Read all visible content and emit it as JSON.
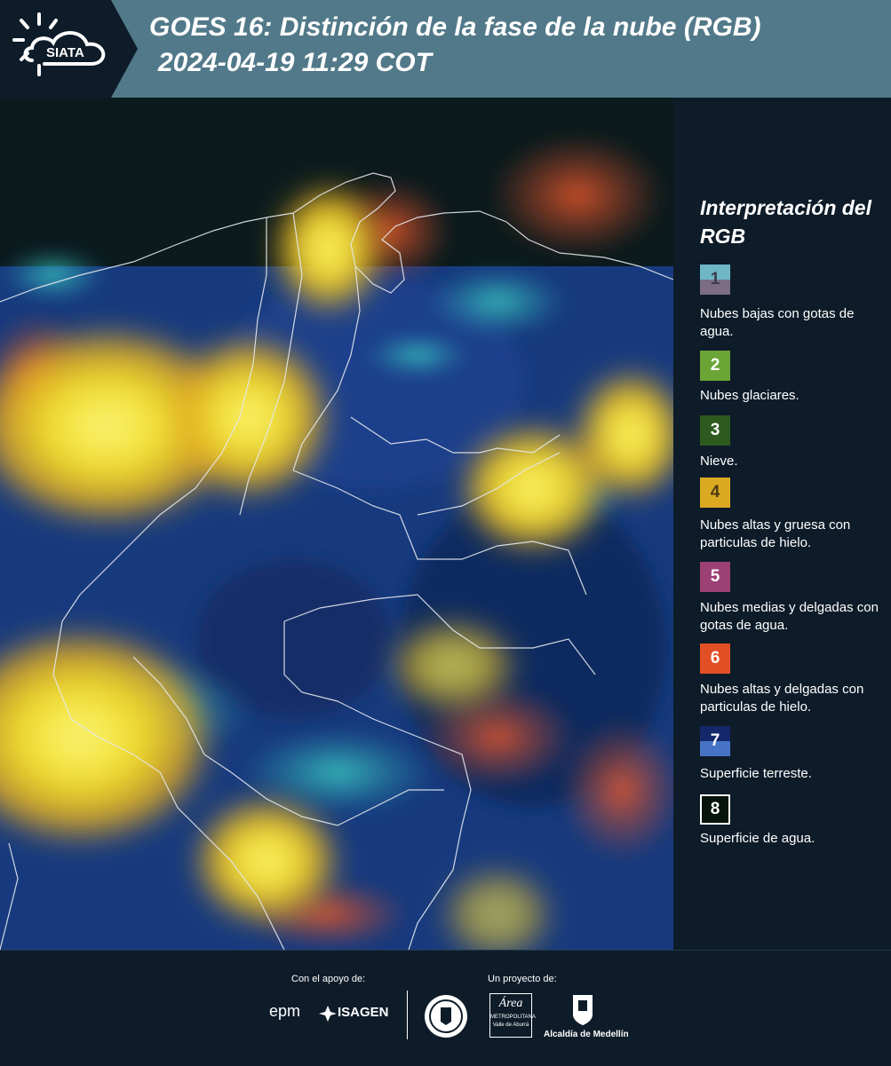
{
  "header": {
    "logo_text": "SIATA",
    "title_line1": "GOES 16: Distinción de la fase de la nube (RGB)",
    "title_line2": "2024-04-19 11:29 COT"
  },
  "legend": {
    "title": "Interpretación del RGB",
    "items": [
      {
        "number": "1",
        "label": "Nubes bajas con gotas de agua.",
        "color_top": "#6fb7c6",
        "color_bottom": "#7c6c86"
      },
      {
        "number": "2",
        "label": "Nubes glaciares.",
        "color": "#6aa536"
      },
      {
        "number": "3",
        "label": "Nieve.",
        "color": "#2e5a1f"
      },
      {
        "number": "4",
        "label": "Nubes altas y gruesa con particulas de hielo.",
        "color": "#dcaa22"
      },
      {
        "number": "5",
        "label": "Nubes medias y delgadas con gotas de agua.",
        "color": "#9c4076"
      },
      {
        "number": "6",
        "label": "Nubes altas y delgadas con particulas de hielo.",
        "color": "#e24f25"
      },
      {
        "number": "7",
        "label": "Superficie terreste.",
        "color_top": "#14276a",
        "color_bottom": "#4773c6"
      },
      {
        "number": "8",
        "label": "Superficie de agua.",
        "color": "#06130a"
      }
    ]
  },
  "footer": {
    "support_label": "Con el apoyo de:",
    "project_label": "Un proyecto de:",
    "sponsors": [
      "epm",
      "ISAGEN"
    ],
    "partners": [
      "Área Metropolitana Valle de Aburrá",
      "Alcaldía de Medellín"
    ],
    "area_text": "Área",
    "area_sub1": "METROPOLITANA",
    "area_sub2": "Valle de Aburrá",
    "alcaldia_text": "Alcaldía de Medellín"
  }
}
